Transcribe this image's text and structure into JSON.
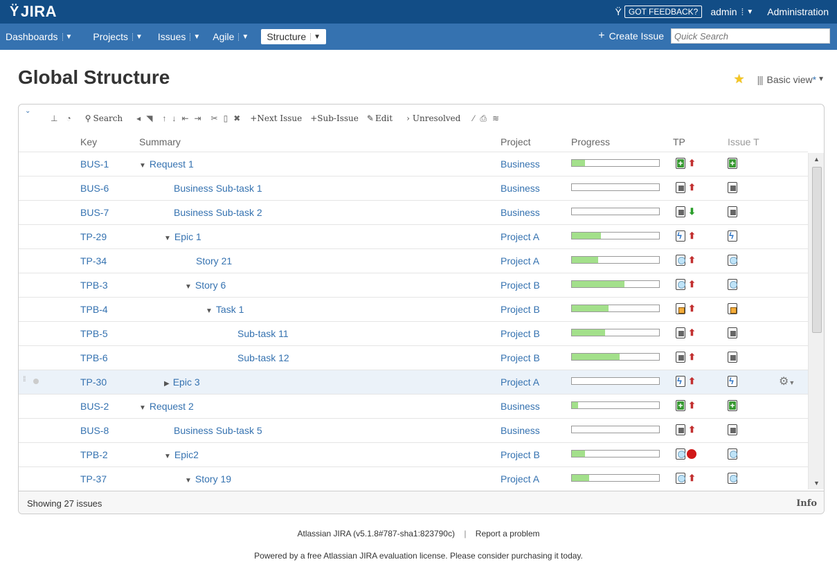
{
  "header": {
    "logo": "JIRA",
    "feedback": "GOT FEEDBACK?",
    "user": "admin",
    "administration": "Administration"
  },
  "nav": {
    "items": [
      {
        "label": "Dashboards"
      },
      {
        "label": "Projects"
      },
      {
        "label": "Issues"
      },
      {
        "label": "Agile"
      },
      {
        "label": "Structure"
      }
    ],
    "create_issue": "Create Issue",
    "quick_search_placeholder": "Quick Search"
  },
  "page": {
    "title": "Global Structure",
    "view": "Basic view",
    "view_modified": "*"
  },
  "toolbar": {
    "search": "Search",
    "next_issue": "+Next Issue",
    "sub_issue": "+Sub-Issue",
    "edit": "Edit",
    "unresolved": "Unresolved"
  },
  "columns": {
    "key": "Key",
    "summary": "Summary",
    "project": "Project",
    "progress": "Progress",
    "tp": "TP",
    "issue_type": "Issue T"
  },
  "rows": [
    {
      "key": "BUS-1",
      "summary": "Request 1",
      "tri": "▼",
      "project": "Business",
      "progress": 0.15,
      "type": "new",
      "priority": "up"
    },
    {
      "key": "BUS-6",
      "summary": "Business Sub-task 1",
      "tri": "",
      "project": "Business",
      "progress": 0,
      "type": "sub",
      "priority": "up"
    },
    {
      "key": "BUS-7",
      "summary": "Business Sub-task 2",
      "tri": "",
      "project": "Business",
      "progress": 0,
      "type": "sub",
      "priority": "down"
    },
    {
      "key": "TP-29",
      "summary": "Epic 1",
      "tri": "▼",
      "project": "Project A",
      "progress": 0.33,
      "type": "epic",
      "priority": "up"
    },
    {
      "key": "TP-34",
      "summary": "Story 21",
      "tri": "",
      "project": "Project A",
      "progress": 0.3,
      "type": "story",
      "priority": "up"
    },
    {
      "key": "TPB-3",
      "summary": "Story 6",
      "tri": "▼",
      "project": "Project B",
      "progress": 0.6,
      "type": "story",
      "priority": "up"
    },
    {
      "key": "TPB-4",
      "summary": "Task 1",
      "tri": "▼",
      "project": "Project B",
      "progress": 0.42,
      "type": "task",
      "priority": "up"
    },
    {
      "key": "TPB-5",
      "summary": "Sub-task 11",
      "tri": "",
      "project": "Project B",
      "progress": 0.38,
      "type": "sub",
      "priority": "up"
    },
    {
      "key": "TPB-6",
      "summary": "Sub-task 12",
      "tri": "",
      "project": "Project B",
      "progress": 0.55,
      "type": "sub",
      "priority": "up"
    },
    {
      "key": "TP-30",
      "summary": "Epic 3",
      "tri": "▶",
      "project": "Project A",
      "progress": 0,
      "type": "epic",
      "priority": "up"
    },
    {
      "key": "BUS-2",
      "summary": "Request 2",
      "tri": "▼",
      "project": "Business",
      "progress": 0.07,
      "type": "new",
      "priority": "up"
    },
    {
      "key": "BUS-8",
      "summary": "Business Sub-task 5",
      "tri": "",
      "project": "Business",
      "progress": 0,
      "type": "sub",
      "priority": "up"
    },
    {
      "key": "TPB-2",
      "summary": "Epic2",
      "tri": "▼",
      "project": "Project B",
      "progress": 0.15,
      "type": "story",
      "priority": "block"
    },
    {
      "key": "TP-37",
      "summary": "Story 19",
      "tri": "▼",
      "project": "Project A",
      "progress": 0.2,
      "type": "story",
      "priority": "up"
    }
  ],
  "footer": {
    "showing": "Showing 27 issues",
    "info": "Info",
    "version": "Atlassian JIRA (v5.1.8#787-sha1:823790c)",
    "report": "Report a problem",
    "license": "Powered by a free Atlassian JIRA evaluation license. Please consider purchasing it today."
  }
}
